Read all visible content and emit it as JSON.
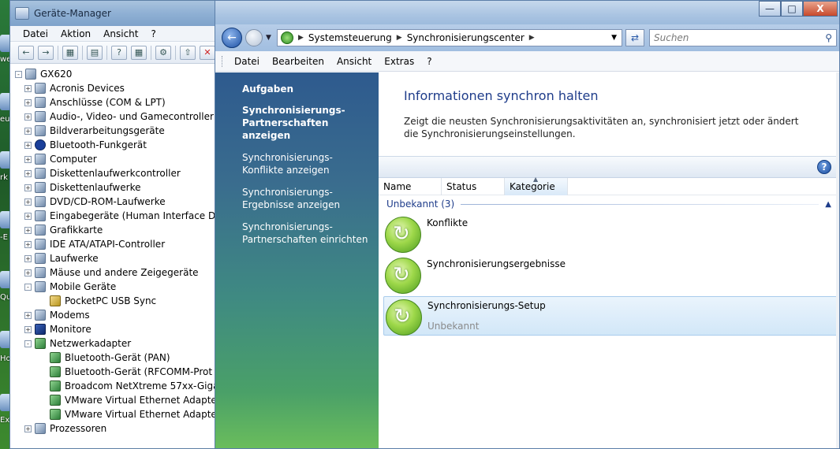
{
  "desktop": {
    "labels": [
      "we",
      "eu",
      "rk",
      "-E",
      "Qu",
      "Ho",
      "Ex"
    ]
  },
  "devmgr": {
    "title": "Geräte-Manager",
    "menu": [
      "Datei",
      "Aktion",
      "Ansicht",
      "?"
    ],
    "root": "GX620",
    "tree": [
      {
        "label": "Acronis Devices",
        "expanded": false,
        "level": 1,
        "icon": "disk-icon"
      },
      {
        "label": "Anschlüsse (COM & LPT)",
        "expanded": false,
        "level": 1,
        "icon": "port-icon"
      },
      {
        "label": "Audio-, Video- und Gamecontroller",
        "expanded": false,
        "level": 1,
        "icon": "audio-icon"
      },
      {
        "label": "Bildverarbeitungsgeräte",
        "expanded": false,
        "level": 1,
        "icon": "camera-icon"
      },
      {
        "label": "Bluetooth-Funkgerät",
        "expanded": false,
        "level": 1,
        "icon": "bluetooth-icon"
      },
      {
        "label": "Computer",
        "expanded": false,
        "level": 1,
        "icon": "computer-icon"
      },
      {
        "label": "Diskettenlaufwerkcontroller",
        "expanded": false,
        "level": 1,
        "icon": "floppy-controller-icon"
      },
      {
        "label": "Diskettenlaufwerke",
        "expanded": false,
        "level": 1,
        "icon": "floppy-icon"
      },
      {
        "label": "DVD/CD-ROM-Laufwerke",
        "expanded": false,
        "level": 1,
        "icon": "dvd-icon"
      },
      {
        "label": "Eingabegeräte (Human Interface De",
        "expanded": false,
        "level": 1,
        "icon": "hid-icon"
      },
      {
        "label": "Grafikkarte",
        "expanded": false,
        "level": 1,
        "icon": "display-adapter-icon"
      },
      {
        "label": "IDE ATA/ATAPI-Controller",
        "expanded": false,
        "level": 1,
        "icon": "ide-icon"
      },
      {
        "label": "Laufwerke",
        "expanded": false,
        "level": 1,
        "icon": "drive-icon"
      },
      {
        "label": "Mäuse und andere Zeigegeräte",
        "expanded": false,
        "level": 1,
        "icon": "mouse-icon"
      },
      {
        "label": "Mobile Geräte",
        "expanded": true,
        "level": 1,
        "icon": "mobile-device-icon"
      },
      {
        "label": "PocketPC USB Sync",
        "expanded": null,
        "level": 2,
        "icon": "pocketpc-icon"
      },
      {
        "label": "Modems",
        "expanded": false,
        "level": 1,
        "icon": "modem-icon"
      },
      {
        "label": "Monitore",
        "expanded": false,
        "level": 1,
        "icon": "monitor-icon"
      },
      {
        "label": "Netzwerkadapter",
        "expanded": true,
        "level": 1,
        "icon": "network-adapter-icon"
      },
      {
        "label": "Bluetooth-Gerät (PAN)",
        "expanded": null,
        "level": 2,
        "icon": "network-adapter-icon"
      },
      {
        "label": "Bluetooth-Gerät (RFCOMM-Prot",
        "expanded": null,
        "level": 2,
        "icon": "network-adapter-icon"
      },
      {
        "label": "Broadcom NetXtreme 57xx-Giga",
        "expanded": null,
        "level": 2,
        "icon": "network-adapter-icon"
      },
      {
        "label": "VMware Virtual Ethernet Adapte",
        "expanded": null,
        "level": 2,
        "icon": "network-adapter-icon"
      },
      {
        "label": "VMware Virtual Ethernet Adapte",
        "expanded": null,
        "level": 2,
        "icon": "network-adapter-icon"
      },
      {
        "label": "Prozessoren",
        "expanded": false,
        "level": 1,
        "icon": "processor-icon"
      }
    ]
  },
  "sync": {
    "window_buttons": {
      "minimize": "—",
      "maximize": "□",
      "close": "X"
    },
    "address": {
      "crumbs": [
        "Systemsteuerung",
        "Synchronisierungscenter"
      ],
      "search_placeholder": "Suchen"
    },
    "menu": [
      "Datei",
      "Bearbeiten",
      "Ansicht",
      "Extras",
      "?"
    ],
    "tasks": {
      "heading": "Aufgaben",
      "links": [
        {
          "label": "Synchronisierungs-Partnerschaften anzeigen",
          "bold": true
        },
        {
          "label": "Synchronisierungs- Konflikte anzeigen",
          "bold": false
        },
        {
          "label": "Synchronisierungs- Ergebnisse anzeigen",
          "bold": false
        },
        {
          "label": "Synchronisierungs-Partnerschaften einrichten",
          "bold": false
        }
      ]
    },
    "main": {
      "title": "Informationen synchron halten",
      "description": "Zeigt die neusten Synchronisierungsaktivitäten an, synchronisiert jetzt oder ändert die Synchronisierungseinstellungen.",
      "columns": [
        "Name",
        "Status",
        "Kategorie"
      ],
      "group": "Unbekannt (3)",
      "items": [
        {
          "name": "Konflikte",
          "sub": ""
        },
        {
          "name": "Synchronisierungsergebnisse",
          "sub": ""
        },
        {
          "name": "Synchronisierungs-Setup",
          "sub": "Unbekannt"
        }
      ]
    }
  },
  "colors": {
    "title_blue": "#1e3c8a",
    "task_pane_top": "#2e5a8e",
    "task_pane_bottom": "#6abd5c"
  }
}
